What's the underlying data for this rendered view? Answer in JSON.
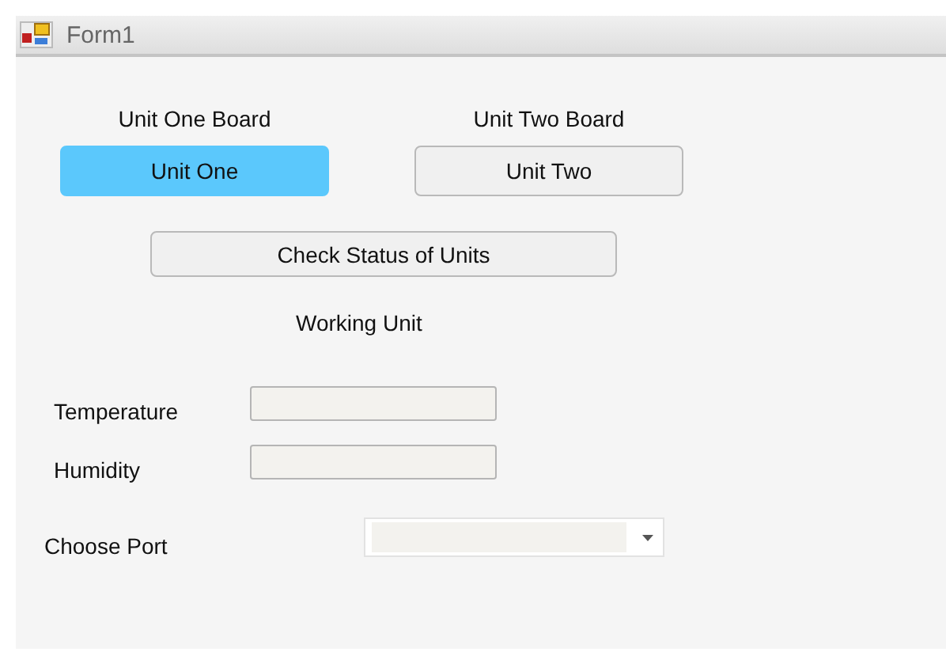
{
  "window": {
    "title": "Form1"
  },
  "units": [
    {
      "board_label": "Unit One Board",
      "button": "Unit One",
      "selected": true
    },
    {
      "board_label": "Unit Two Board",
      "button": "Unit Two",
      "selected": false
    }
  ],
  "check_button": "Check Status of Units",
  "status_label": "Working Unit",
  "fields": [
    {
      "label": "Temperature"
    },
    {
      "label": "Humidity"
    }
  ],
  "port": {
    "label": "Choose Port"
  }
}
